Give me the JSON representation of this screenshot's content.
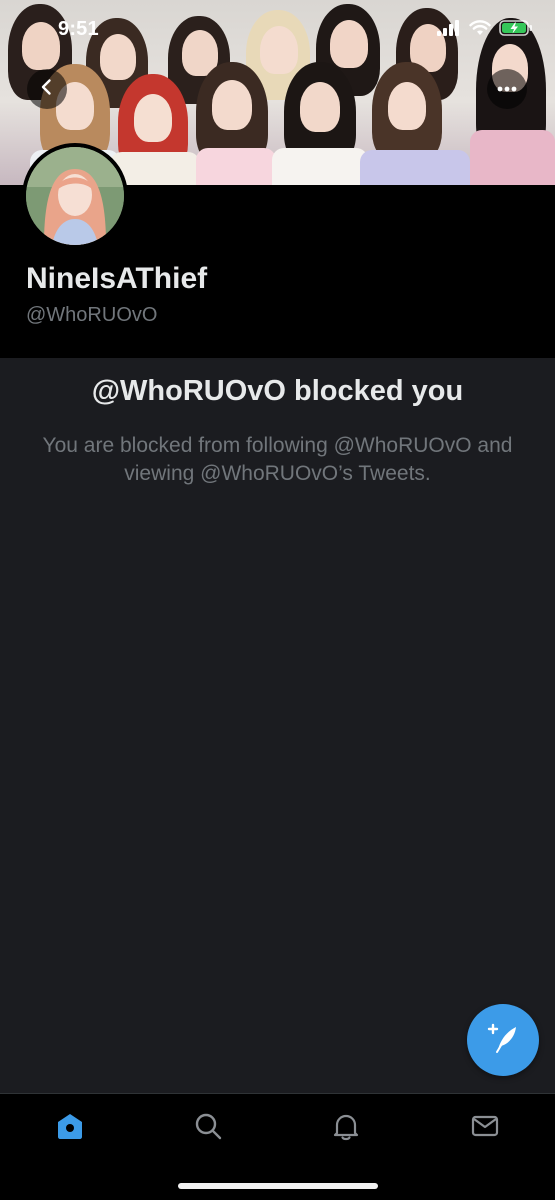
{
  "status_bar": {
    "time": "9:51"
  },
  "profile": {
    "display_name": "NineIsAThief",
    "handle": "@WhoRUOvO"
  },
  "blocked": {
    "title": "@WhoRUOvO blocked you",
    "message": "You are blocked from following @WhoRUOvO and viewing @WhoRUOvO’s Tweets."
  },
  "tabbar": {
    "items": [
      {
        "icon": "home-icon",
        "active": true
      },
      {
        "icon": "search-icon",
        "active": false
      },
      {
        "icon": "bell-icon",
        "active": false
      },
      {
        "icon": "mail-icon",
        "active": false
      }
    ]
  },
  "colors": {
    "accent": "#3c9be8",
    "background": "#1b1c20",
    "header_background": "#000000",
    "secondary_text": "#71767b"
  }
}
